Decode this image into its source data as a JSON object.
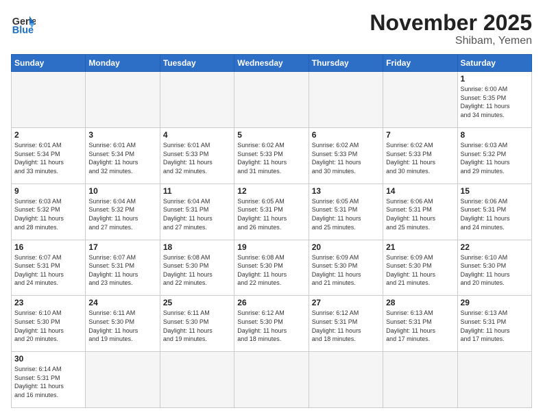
{
  "header": {
    "logo_general": "General",
    "logo_blue": "Blue",
    "month_title": "November 2025",
    "location": "Shibam, Yemen"
  },
  "weekdays": [
    "Sunday",
    "Monday",
    "Tuesday",
    "Wednesday",
    "Thursday",
    "Friday",
    "Saturday"
  ],
  "weeks": [
    [
      {
        "day": "",
        "info": ""
      },
      {
        "day": "",
        "info": ""
      },
      {
        "day": "",
        "info": ""
      },
      {
        "day": "",
        "info": ""
      },
      {
        "day": "",
        "info": ""
      },
      {
        "day": "",
        "info": ""
      },
      {
        "day": "1",
        "info": "Sunrise: 6:00 AM\nSunset: 5:35 PM\nDaylight: 11 hours\nand 34 minutes."
      }
    ],
    [
      {
        "day": "2",
        "info": "Sunrise: 6:01 AM\nSunset: 5:34 PM\nDaylight: 11 hours\nand 33 minutes."
      },
      {
        "day": "3",
        "info": "Sunrise: 6:01 AM\nSunset: 5:34 PM\nDaylight: 11 hours\nand 32 minutes."
      },
      {
        "day": "4",
        "info": "Sunrise: 6:01 AM\nSunset: 5:33 PM\nDaylight: 11 hours\nand 32 minutes."
      },
      {
        "day": "5",
        "info": "Sunrise: 6:02 AM\nSunset: 5:33 PM\nDaylight: 11 hours\nand 31 minutes."
      },
      {
        "day": "6",
        "info": "Sunrise: 6:02 AM\nSunset: 5:33 PM\nDaylight: 11 hours\nand 30 minutes."
      },
      {
        "day": "7",
        "info": "Sunrise: 6:02 AM\nSunset: 5:33 PM\nDaylight: 11 hours\nand 30 minutes."
      },
      {
        "day": "8",
        "info": "Sunrise: 6:03 AM\nSunset: 5:32 PM\nDaylight: 11 hours\nand 29 minutes."
      }
    ],
    [
      {
        "day": "9",
        "info": "Sunrise: 6:03 AM\nSunset: 5:32 PM\nDaylight: 11 hours\nand 28 minutes."
      },
      {
        "day": "10",
        "info": "Sunrise: 6:04 AM\nSunset: 5:32 PM\nDaylight: 11 hours\nand 27 minutes."
      },
      {
        "day": "11",
        "info": "Sunrise: 6:04 AM\nSunset: 5:31 PM\nDaylight: 11 hours\nand 27 minutes."
      },
      {
        "day": "12",
        "info": "Sunrise: 6:05 AM\nSunset: 5:31 PM\nDaylight: 11 hours\nand 26 minutes."
      },
      {
        "day": "13",
        "info": "Sunrise: 6:05 AM\nSunset: 5:31 PM\nDaylight: 11 hours\nand 25 minutes."
      },
      {
        "day": "14",
        "info": "Sunrise: 6:06 AM\nSunset: 5:31 PM\nDaylight: 11 hours\nand 25 minutes."
      },
      {
        "day": "15",
        "info": "Sunrise: 6:06 AM\nSunset: 5:31 PM\nDaylight: 11 hours\nand 24 minutes."
      }
    ],
    [
      {
        "day": "16",
        "info": "Sunrise: 6:07 AM\nSunset: 5:31 PM\nDaylight: 11 hours\nand 24 minutes."
      },
      {
        "day": "17",
        "info": "Sunrise: 6:07 AM\nSunset: 5:31 PM\nDaylight: 11 hours\nand 23 minutes."
      },
      {
        "day": "18",
        "info": "Sunrise: 6:08 AM\nSunset: 5:30 PM\nDaylight: 11 hours\nand 22 minutes."
      },
      {
        "day": "19",
        "info": "Sunrise: 6:08 AM\nSunset: 5:30 PM\nDaylight: 11 hours\nand 22 minutes."
      },
      {
        "day": "20",
        "info": "Sunrise: 6:09 AM\nSunset: 5:30 PM\nDaylight: 11 hours\nand 21 minutes."
      },
      {
        "day": "21",
        "info": "Sunrise: 6:09 AM\nSunset: 5:30 PM\nDaylight: 11 hours\nand 21 minutes."
      },
      {
        "day": "22",
        "info": "Sunrise: 6:10 AM\nSunset: 5:30 PM\nDaylight: 11 hours\nand 20 minutes."
      }
    ],
    [
      {
        "day": "23",
        "info": "Sunrise: 6:10 AM\nSunset: 5:30 PM\nDaylight: 11 hours\nand 20 minutes."
      },
      {
        "day": "24",
        "info": "Sunrise: 6:11 AM\nSunset: 5:30 PM\nDaylight: 11 hours\nand 19 minutes."
      },
      {
        "day": "25",
        "info": "Sunrise: 6:11 AM\nSunset: 5:30 PM\nDaylight: 11 hours\nand 19 minutes."
      },
      {
        "day": "26",
        "info": "Sunrise: 6:12 AM\nSunset: 5:30 PM\nDaylight: 11 hours\nand 18 minutes."
      },
      {
        "day": "27",
        "info": "Sunrise: 6:12 AM\nSunset: 5:31 PM\nDaylight: 11 hours\nand 18 minutes."
      },
      {
        "day": "28",
        "info": "Sunrise: 6:13 AM\nSunset: 5:31 PM\nDaylight: 11 hours\nand 17 minutes."
      },
      {
        "day": "29",
        "info": "Sunrise: 6:13 AM\nSunset: 5:31 PM\nDaylight: 11 hours\nand 17 minutes."
      }
    ],
    [
      {
        "day": "30",
        "info": "Sunrise: 6:14 AM\nSunset: 5:31 PM\nDaylight: 11 hours\nand 16 minutes."
      },
      {
        "day": "",
        "info": ""
      },
      {
        "day": "",
        "info": ""
      },
      {
        "day": "",
        "info": ""
      },
      {
        "day": "",
        "info": ""
      },
      {
        "day": "",
        "info": ""
      },
      {
        "day": "",
        "info": ""
      }
    ]
  ]
}
